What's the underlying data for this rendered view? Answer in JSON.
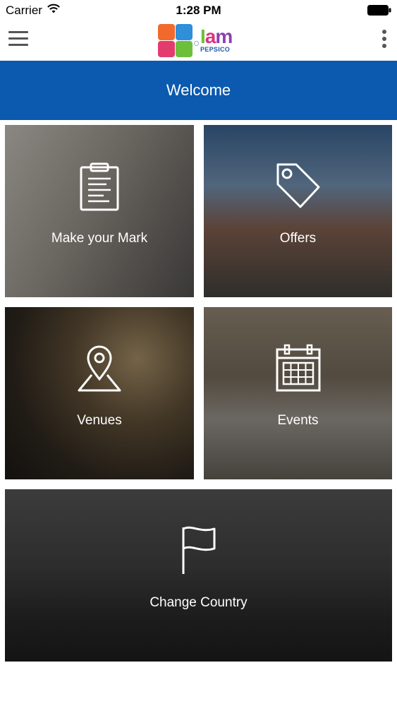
{
  "status_bar": {
    "carrier": "Carrier",
    "time": "1:28 PM"
  },
  "header": {
    "logo": {
      "brand": [
        "I",
        "a",
        "m"
      ],
      "sub": "PEPSICO"
    },
    "menu_icon": "hamburger-icon",
    "more_icon": "more-vertical-icon"
  },
  "banner": {
    "title": "Welcome"
  },
  "tiles": [
    {
      "label": "Make your Mark",
      "icon": "clipboard-icon"
    },
    {
      "label": "Offers",
      "icon": "tag-icon"
    },
    {
      "label": "Venues",
      "icon": "map-pin-icon"
    },
    {
      "label": "Events",
      "icon": "calendar-icon"
    },
    {
      "label": "Change Country",
      "icon": "flag-icon"
    }
  ],
  "colors": {
    "banner": "#0b5aaf",
    "logo_green": "#6cbf3b",
    "logo_pink": "#e0317f",
    "logo_purple": "#8b3fb0",
    "logo_blue": "#1d5aa6"
  }
}
